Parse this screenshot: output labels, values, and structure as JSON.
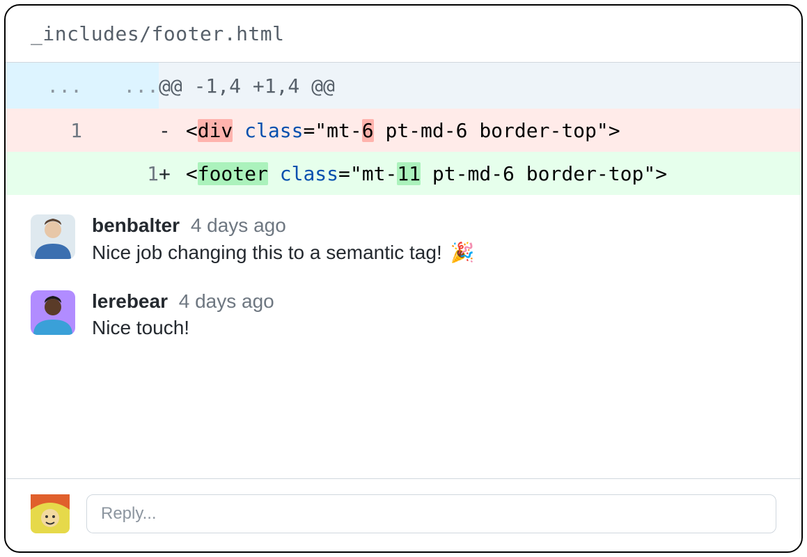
{
  "file_path": "_includes/footer.html",
  "diff": {
    "hunk_header": "@@ -1,4 +1,4 @@",
    "hunk_ellipsis": "...",
    "removed": {
      "old_line": "1",
      "new_line": "",
      "marker": "-",
      "segments": {
        "open": "<",
        "tag": "div",
        "space1": " ",
        "attr": "class",
        "eq_q": "=\"mt-",
        "num": "6",
        "tail": " pt-md-6 border-top\">"
      }
    },
    "added": {
      "old_line": "",
      "new_line": "1",
      "marker": "+",
      "segments": {
        "open": "<",
        "tag": "footer",
        "space1": " ",
        "attr": "class",
        "eq_q": "=\"mt-",
        "num": "11",
        "tail": " pt-md-6 border-top\">"
      }
    }
  },
  "comments": [
    {
      "author": "benbalter",
      "time": "4 days ago",
      "text": "Nice job changing this to a semantic tag! ",
      "emoji": "🎉"
    },
    {
      "author": "lerebear",
      "time": "4 days ago",
      "text": "Nice touch!",
      "emoji": ""
    }
  ],
  "reply": {
    "placeholder": "Reply..."
  }
}
